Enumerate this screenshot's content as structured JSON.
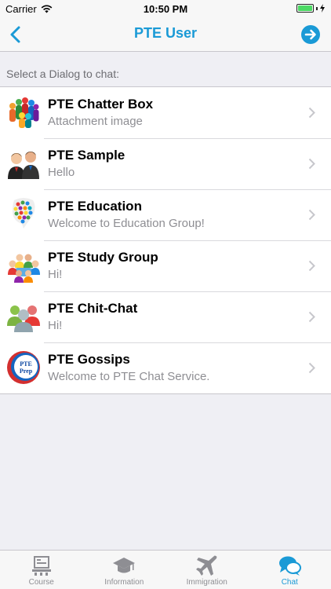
{
  "status_bar": {
    "carrier": "Carrier",
    "time": "10:50 PM"
  },
  "nav": {
    "title": "PTE User",
    "back_icon": "chevron-left-icon",
    "forward_icon": "arrow-right-circle-icon"
  },
  "section_header": "Select a Dialog to chat:",
  "dialogs": [
    {
      "title": "PTE Chatter Box",
      "subtitle": "Attachment image",
      "icon": "people-group-icon"
    },
    {
      "title": "PTE Sample",
      "subtitle": "Hello",
      "icon": "two-people-icon"
    },
    {
      "title": "PTE Education",
      "subtitle": "Welcome to Education Group!",
      "icon": "speech-bubble-crowd-icon"
    },
    {
      "title": "PTE Study Group",
      "subtitle": "Hi!",
      "icon": "study-group-icon"
    },
    {
      "title": "PTE Chit-Chat",
      "subtitle": "Hi!",
      "icon": "three-people-icon"
    },
    {
      "title": "PTE Gossips",
      "subtitle": "Welcome to PTE Chat Service.",
      "icon": "pte-prep-logo"
    }
  ],
  "logo_text": {
    "line1": "PTE",
    "line2": "Prep"
  },
  "tabs": [
    {
      "label": "Course",
      "icon": "course-icon",
      "active": false
    },
    {
      "label": "Information",
      "icon": "graduation-cap-icon",
      "active": false
    },
    {
      "label": "Immigration",
      "icon": "airplane-icon",
      "active": false
    },
    {
      "label": "Chat",
      "icon": "chat-bubbles-icon",
      "active": true
    }
  ],
  "colors": {
    "accent": "#1a9ad6",
    "battery": "#4cd964"
  }
}
